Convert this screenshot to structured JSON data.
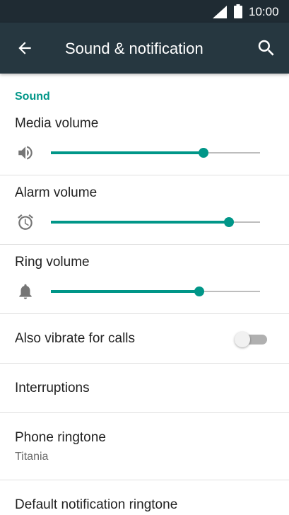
{
  "status_bar": {
    "time": "10:00",
    "signal_icon": "signal-icon",
    "battery_icon": "battery-icon"
  },
  "app_bar": {
    "title": "Sound & notification",
    "back_icon": "arrow-back-icon",
    "search_icon": "search-icon"
  },
  "section": {
    "header": "Sound"
  },
  "volumes": [
    {
      "label": "Media volume",
      "icon": "speaker-icon",
      "level": 0.73
    },
    {
      "label": "Alarm volume",
      "icon": "alarm-clock-icon",
      "level": 0.85
    },
    {
      "label": "Ring volume",
      "icon": "bell-icon",
      "level": 0.71
    }
  ],
  "vibrate": {
    "label": "Also vibrate for calls",
    "enabled": false
  },
  "interruptions": {
    "label": "Interruptions"
  },
  "phone_ringtone": {
    "label": "Phone ringtone",
    "value": "Titania"
  },
  "notification_ringtone": {
    "label": "Default notification ringtone"
  },
  "colors": {
    "accent": "#009688",
    "app_bar": "#263740",
    "status_bar": "#1f2b33"
  }
}
